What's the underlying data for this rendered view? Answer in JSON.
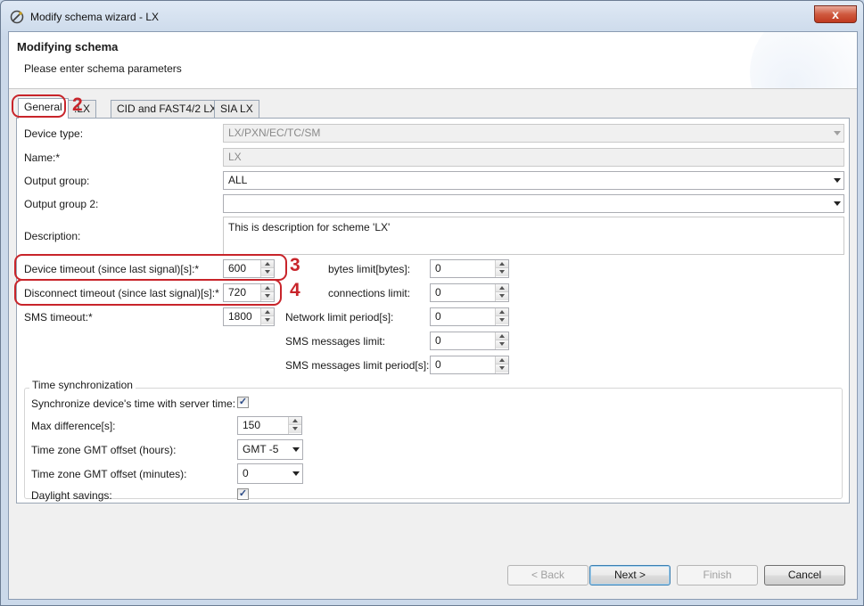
{
  "window": {
    "title": "Modify schema wizard - LX",
    "close_glyph": "x"
  },
  "header": {
    "title": "Modifying schema",
    "subtitle": "Please enter schema parameters"
  },
  "tabs": [
    {
      "label": "General",
      "active": true
    },
    {
      "label": ".LX",
      "active": false
    },
    {
      "label": "CID and FAST4/2 LX",
      "active": false
    },
    {
      "label": "SIA LX",
      "active": false
    }
  ],
  "form": {
    "device_type": {
      "label": "Device type:",
      "value": "LX/PXN/EC/TC/SM"
    },
    "name": {
      "label": "Name:*",
      "value": "LX"
    },
    "output_group": {
      "label": "Output group:",
      "value": "ALL"
    },
    "output_group_2": {
      "label": "Output group 2:",
      "value": ""
    },
    "description": {
      "label": "Description:",
      "value": "This is description for scheme 'LX'"
    },
    "device_timeout": {
      "label": "Device timeout (since last signal)[s]:*",
      "value": "600"
    },
    "disconnect_timeout": {
      "label": "Disconnect timeout (since last signal)[s]:*",
      "value": "720"
    },
    "sms_timeout": {
      "label": "SMS timeout:*",
      "value": "1800"
    },
    "bytes_limit": {
      "label": "bytes limit[bytes]:",
      "value": "0"
    },
    "connections_limit": {
      "label": "connections limit:",
      "value": "0"
    },
    "network_limit_period": {
      "label": "Network limit period[s]:",
      "value": "0"
    },
    "sms_messages_limit": {
      "label": "SMS messages limit:",
      "value": "0"
    },
    "sms_messages_limit_period": {
      "label": "SMS messages limit period[s]:",
      "value": "0"
    }
  },
  "time_sync": {
    "title": "Time synchronization",
    "sync_label": "Synchronize device's time with server time:",
    "sync_checked": true,
    "max_diff_label": "Max difference[s]:",
    "max_diff_value": "150",
    "tz_hours_label": "Time zone GMT offset (hours):",
    "tz_hours_value": "GMT -5",
    "tz_minutes_label": "Time zone GMT offset (minutes):",
    "tz_minutes_value": "0",
    "dst_label": "Daylight savings:",
    "dst_checked": true,
    "check_glyph": "✓"
  },
  "annotations": {
    "n2": "2",
    "n3": "3",
    "n4": "4",
    "color": "#c8242a"
  },
  "buttons": {
    "back": "< Back",
    "next": "Next >",
    "finish": "Finish",
    "cancel": "Cancel"
  }
}
